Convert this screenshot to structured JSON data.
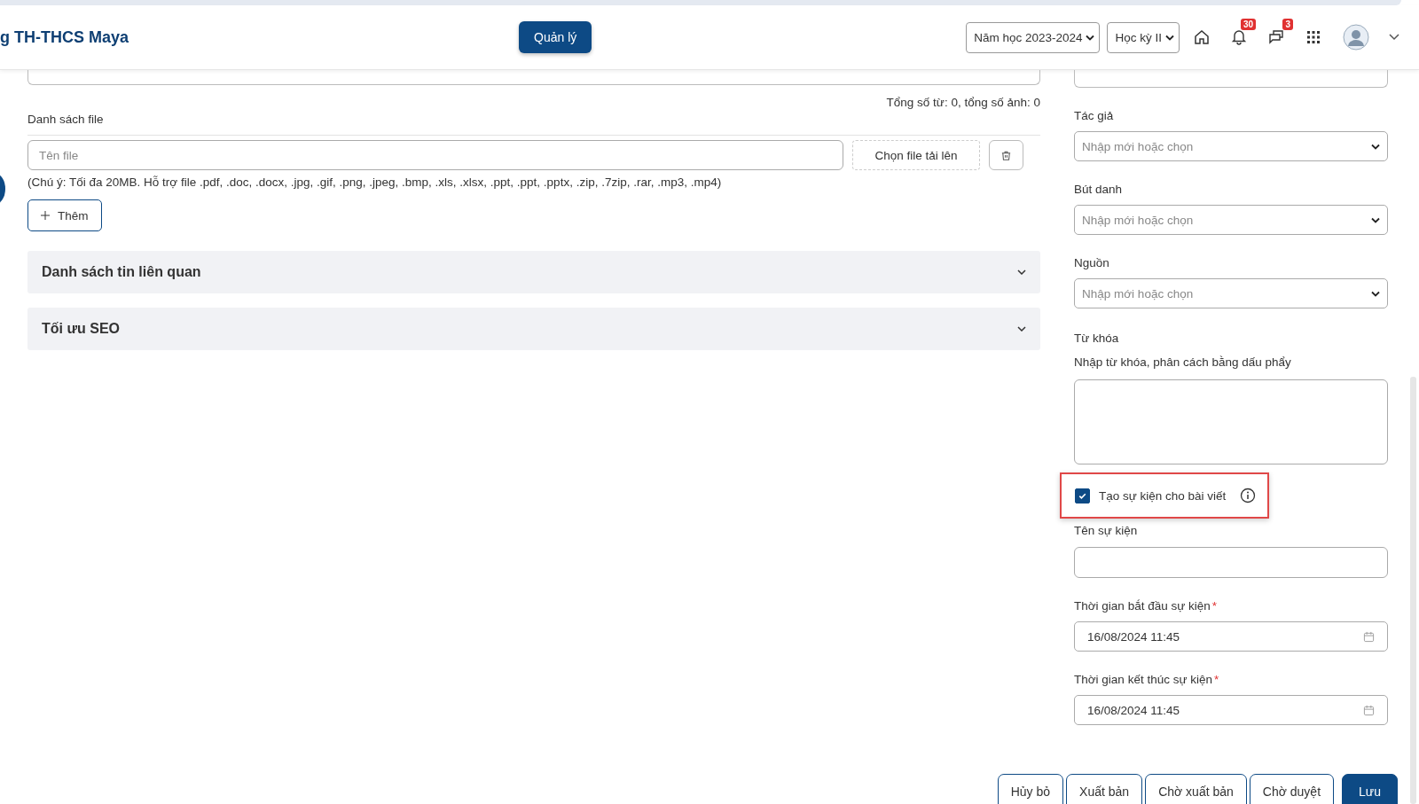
{
  "header": {
    "brand": "g TH-THCS Maya",
    "manage_button": "Quản lý",
    "school_year": "Năm học 2023-2024",
    "semester": "Học kỳ II",
    "notifications_badge": "30",
    "messages_badge": "3"
  },
  "main": {
    "word_count": "Tổng số từ: 0, tổng số ảnh: 0",
    "file_section": {
      "label": "Danh sách file",
      "file_name_placeholder": "Tên file",
      "upload_button": "Chọn file tải lên",
      "note": "(Chú ý: Tối đa 20MB. Hỗ trợ file .pdf, .doc, .docx, .jpg, .gif, .png, .jpeg, .bmp, .xls, .xlsx, .ppt, .ppt, .pptx, .zip, .7zip, .rar, .mp3, .mp4)",
      "add_button": "Thêm"
    },
    "accordions": [
      {
        "title": "Danh sách tin liên quan",
        "expanded": false
      },
      {
        "title": "Tối ưu SEO",
        "expanded": false
      }
    ]
  },
  "sidebar": {
    "selects": [
      {
        "label": "Tác giả",
        "placeholder": "Nhập mới hoặc chọn"
      },
      {
        "label": "Bút danh",
        "placeholder": "Nhập mới hoặc chọn"
      },
      {
        "label": "Nguồn",
        "placeholder": "Nhập mới hoặc chọn"
      }
    ],
    "keywords": {
      "label": "Từ khóa",
      "hint": "Nhập từ khóa, phân cách bằng dấu phẩy"
    },
    "create_event": {
      "label": "Tạo sự kiện cho bài viết",
      "checked": true
    },
    "event_name": {
      "label": "Tên sự kiện"
    },
    "dates": [
      {
        "label": "Thời gian bắt đầu sự kiện",
        "required_mark": "*",
        "value": "16/08/2024 11:45"
      },
      {
        "label": "Thời gian kết thúc sự kiện",
        "required_mark": "*",
        "value": "16/08/2024 11:45"
      }
    ]
  },
  "footer_buttons": [
    {
      "label": "Hủy bỏ",
      "kind": "outline"
    },
    {
      "label": "Xuất bản",
      "kind": "outline"
    },
    {
      "label": "Chờ xuất bản",
      "kind": "outline"
    },
    {
      "label": "Chờ duyệt",
      "kind": "outline"
    },
    {
      "label": "Lưu",
      "kind": "primary"
    }
  ]
}
